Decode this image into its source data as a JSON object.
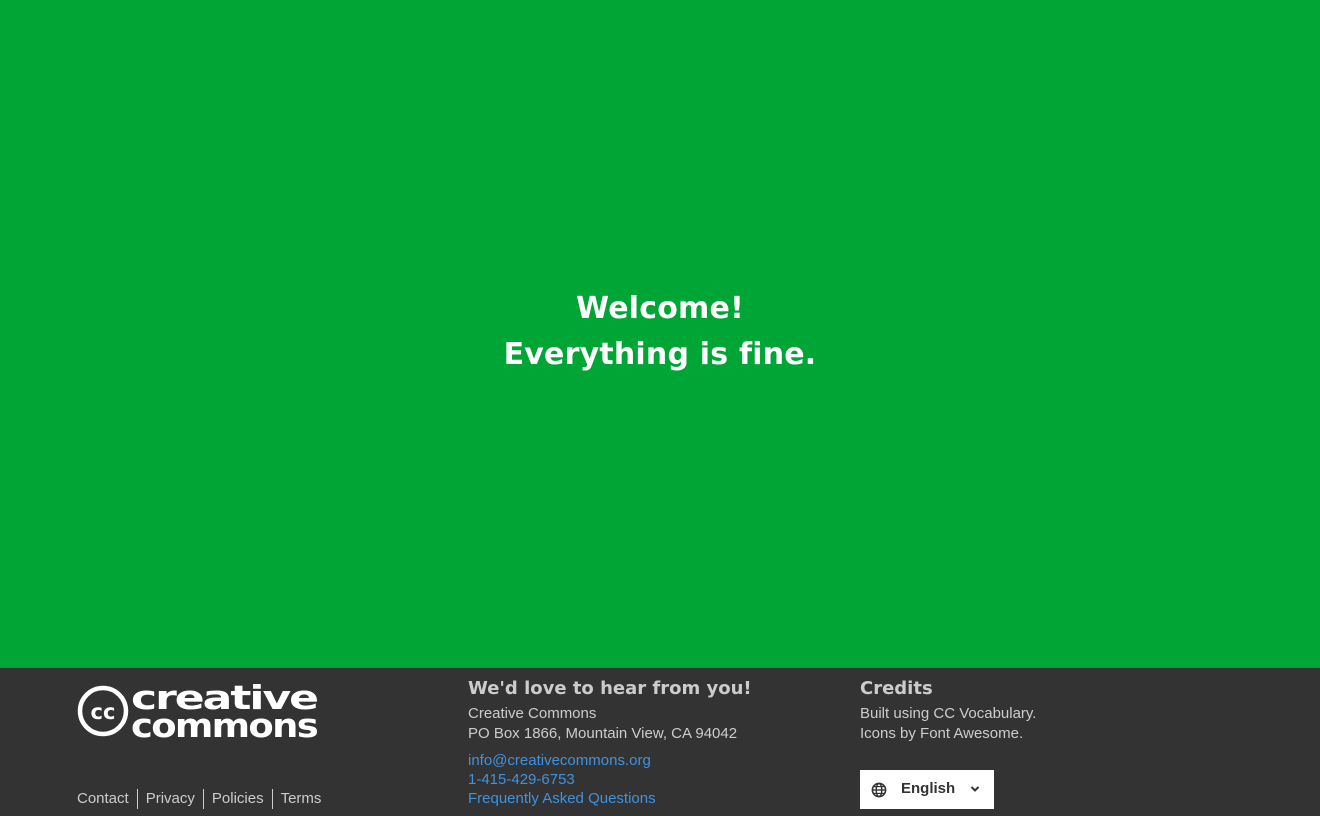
{
  "hero": {
    "line1": "Welcome!",
    "line2": "Everything is fine.",
    "background_color": "#00a635"
  },
  "footer": {
    "background_color": "#333333",
    "logo": {
      "icon": "cc-logo-icon",
      "text_top": "creative",
      "text_bottom": "commons",
      "badge": "cc"
    },
    "legal_links": [
      {
        "label": "Contact"
      },
      {
        "label": "Privacy"
      },
      {
        "label": "Policies"
      },
      {
        "label": "Terms"
      }
    ],
    "contact": {
      "heading": "We'd love to hear from you!",
      "org_name": "Creative Commons",
      "address": "PO Box 1866, Mountain View, CA 94042",
      "email": "info@creativecommons.org",
      "phone": "1-415-429-6753",
      "faq_label": "Frequently Asked Questions",
      "link_color": "#3f92e0"
    },
    "credits": {
      "heading": "Credits",
      "line1": "Built using CC Vocabulary.",
      "line2": "Icons by Font Awesome."
    },
    "language_select": {
      "icon": "globe-icon",
      "selected": "English",
      "chevron_icon": "chevron-down-icon"
    }
  }
}
